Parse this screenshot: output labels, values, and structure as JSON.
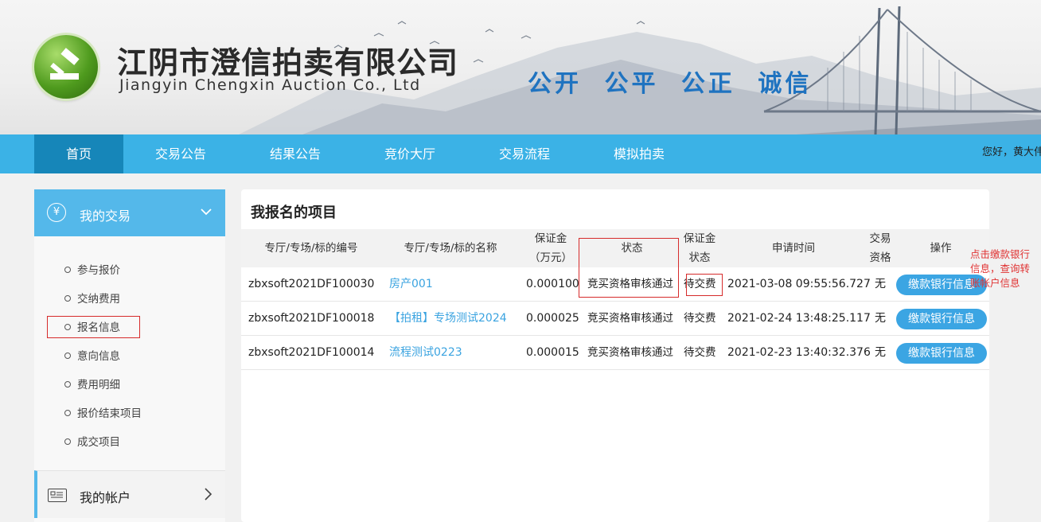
{
  "header": {
    "company_cn": "江阴市澄信拍卖有限公司",
    "company_en": "Jiangyin Chengxin Auction Co., Ltd",
    "slogan": "公开 公平 公正 诚信"
  },
  "nav": {
    "items": [
      "首页",
      "交易公告",
      "结果公告",
      "竞价大厅",
      "交易流程",
      "模拟拍卖"
    ],
    "greeting": "您好，黄大伟"
  },
  "sidebar": {
    "title": "我的交易",
    "items": [
      "参与报价",
      "交纳费用",
      "报名信息",
      "意向信息",
      "费用明细",
      "报价结束项目",
      "成交项目"
    ],
    "account": "我的帐户"
  },
  "panel": {
    "title": "我报名的项目",
    "headers": [
      "专厅/专场/标的编号",
      "专厅/专场/标的名称",
      "保证金\n（万元）",
      "状态",
      "保证金\n状态",
      "申请时间",
      "交易\n资格",
      "操作"
    ],
    "rows": [
      {
        "code": "zbxsoft2021DF100030",
        "name": "房产001",
        "deposit": "0.000100",
        "status": "竞买资格审核通过",
        "deposit_status": "待交费",
        "time": "2021-03-08 09:55:56.727",
        "qual": "无",
        "action": "缴款银行信息"
      },
      {
        "code": "zbxsoft2021DF100018",
        "name": "【拍租】专场测试2024",
        "deposit": "0.000025",
        "status": "竞买资格审核通过",
        "deposit_status": "待交费",
        "time": "2021-02-24 13:48:25.117",
        "qual": "无",
        "action": "缴款银行信息"
      },
      {
        "code": "zbxsoft2021DF100014",
        "name": "流程测试0223",
        "deposit": "0.000015",
        "status": "竞买资格审核通过",
        "deposit_status": "待交费",
        "time": "2021-02-23 13:40:32.376",
        "qual": "无",
        "action": "缴款银行信息"
      }
    ]
  },
  "annotation": "点击缴款银行信息，查询转账帐户信息",
  "colors": {
    "nav": "#3bb2e6",
    "nav_active": "#1686b9",
    "sidebar_head": "#54b8ea",
    "button": "#3ba5e3",
    "link": "#3aa3e0",
    "annotation": "#d62b2b"
  }
}
